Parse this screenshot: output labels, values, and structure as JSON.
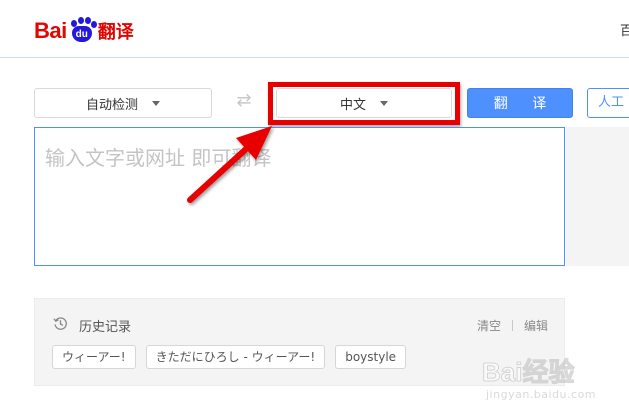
{
  "header": {
    "logo": {
      "bai": "Bai",
      "du": "du",
      "product": "翻译"
    },
    "right_text": "百"
  },
  "lang_bar": {
    "source_lang": "自动检测",
    "target_lang": "中文",
    "swap_symbol": "⇄",
    "translate_label": "翻 译",
    "human_label": "人工"
  },
  "input": {
    "placeholder": "输入文字或网址 即可翻译"
  },
  "history": {
    "title": "历史记录",
    "clear_label": "清空",
    "edit_label": "编辑",
    "items": [
      {
        "label": "ウィーアー!"
      },
      {
        "label": "きただにひろし - ウィーアー!"
      },
      {
        "label": "boystyle"
      }
    ]
  },
  "watermark": {
    "brand": "Bai经验",
    "url": "jingyan.baidu.com"
  },
  "colors": {
    "brand_red": "#e10602",
    "brand_blue": "#2319dc",
    "accent_blue": "#4d90fe",
    "highlight_red": "#e80000"
  }
}
